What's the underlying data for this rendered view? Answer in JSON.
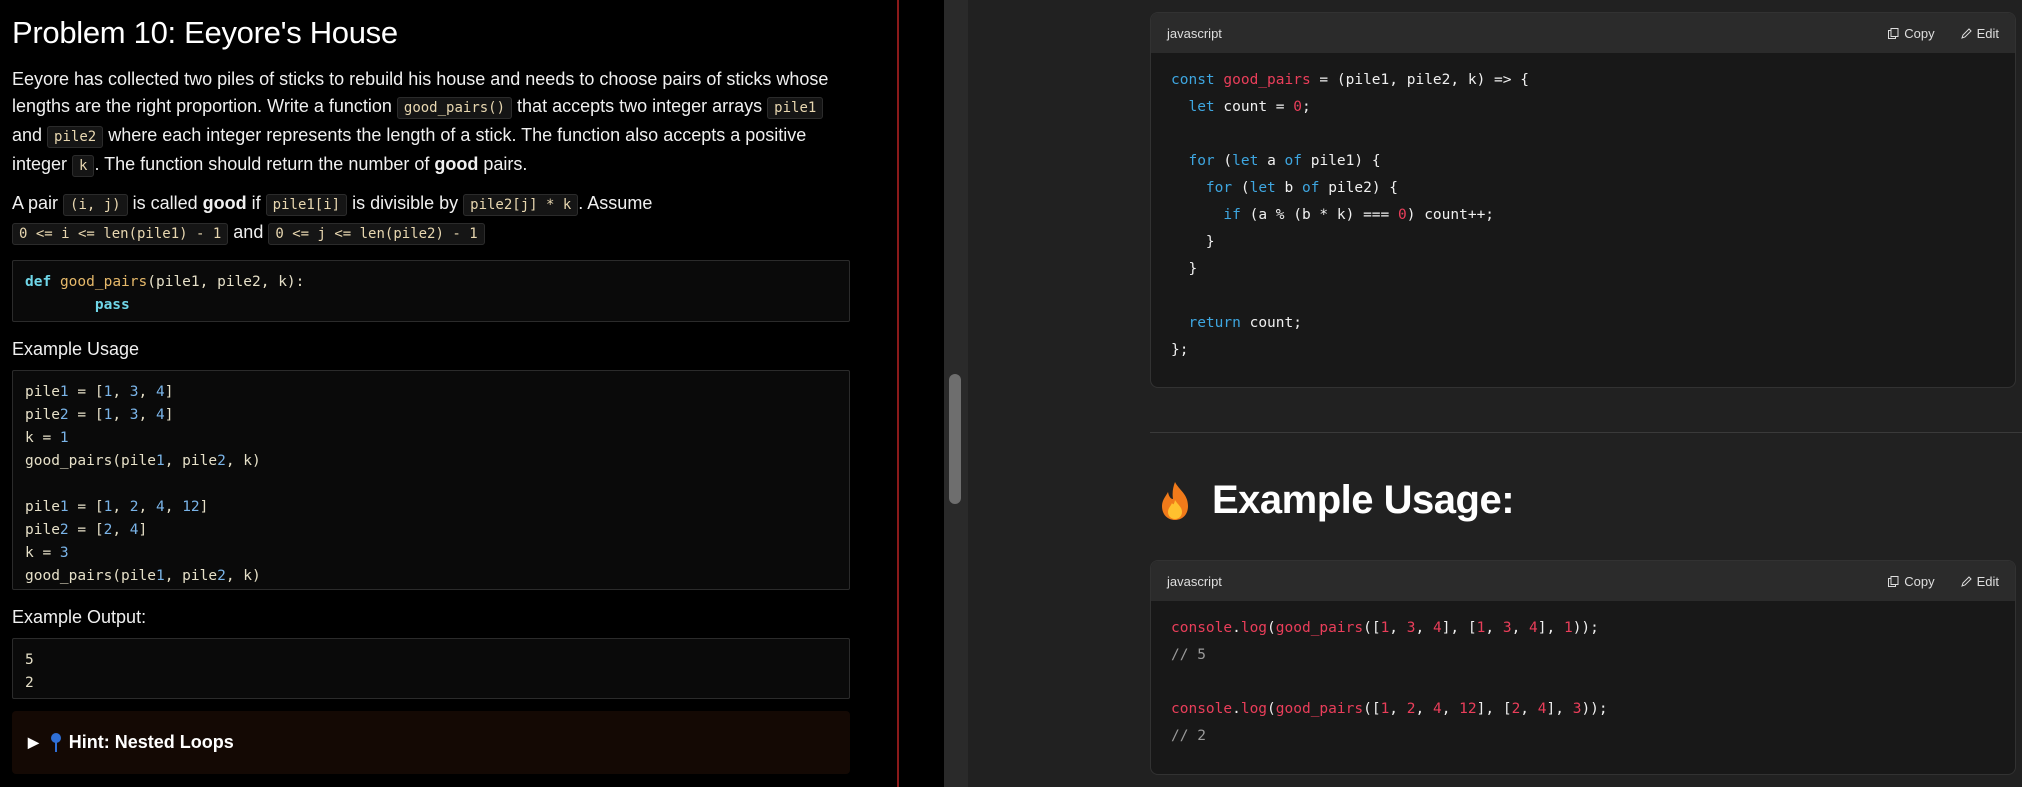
{
  "problem": {
    "title": "Problem 10: Eeyore's House",
    "p1": {
      "t1": "Eeyore has collected two piles of sticks to rebuild his house and needs to choose pairs of sticks whose lengths are the right proportion. Write a function ",
      "c1": "good_pairs()",
      "t2": " that accepts two integer arrays ",
      "c2": "pile1",
      "t3": " and ",
      "c3": "pile2",
      "t4": " where each integer represents the length of a stick. The function also accepts a positive integer ",
      "c4": "k",
      "t5": ". The function should return the number of ",
      "b1": "good",
      "t6": " pairs."
    },
    "p2": {
      "t1": "A pair ",
      "c1": "(i, j)",
      "t2": " is called ",
      "b1": "good",
      "t3": " if ",
      "c2": "pile1[i]",
      "t4": " is divisible by ",
      "c3": "pile2[j] * k",
      "t5": ". Assume ",
      "c4": "0 <= i <= len(pile1) - 1",
      "t6": " and ",
      "c5": "0 <= j <= len(pile2) - 1"
    },
    "def_block": {
      "kw_def": "def",
      "fn_name": "good_pairs",
      "params": "(pile1, pile2, k):",
      "kw_pass": "pass"
    },
    "example_usage_label": "Example Usage",
    "example_usage_lines": [
      "pile1 = [1, 3, 4]",
      "pile2 = [1, 3, 4]",
      "k = 1",
      "good_pairs(pile1, pile2, k)",
      "",
      "pile1 = [1, 2, 4, 12]",
      "pile2 = [2, 4]",
      "k = 3",
      "good_pairs(pile1, pile2, k)"
    ],
    "example_output_label": "Example Output:",
    "example_output_lines": [
      "5",
      "2"
    ],
    "hint_label": "Hint: Nested Loops"
  },
  "answer": {
    "lang_1": "javascript",
    "copy_label": "Copy",
    "edit_label": "Edit",
    "code_1": [
      "const good_pairs = (pile1, pile2, k) => {",
      "  let count = 0;",
      "",
      "  for (let a of pile1) {",
      "    for (let b of pile2) {",
      "      if (a % (b * k) === 0) count++;",
      "    }",
      "  }",
      "",
      "  return count;",
      "};"
    ],
    "example_heading": "Example Usage:",
    "lang_2": "javascript",
    "code_2": [
      "console.log(good_pairs([1, 3, 4], [1, 3, 4], 1));",
      "// 5",
      "",
      "console.log(good_pairs([1, 2, 4, 12], [2, 4], 3));",
      "// 2"
    ]
  },
  "colors": {
    "divider": "#8b1a1a",
    "js_keyword": "#3ea6e0",
    "js_function": "#ea3e5a",
    "py_keyword": "#6fd6e8"
  }
}
